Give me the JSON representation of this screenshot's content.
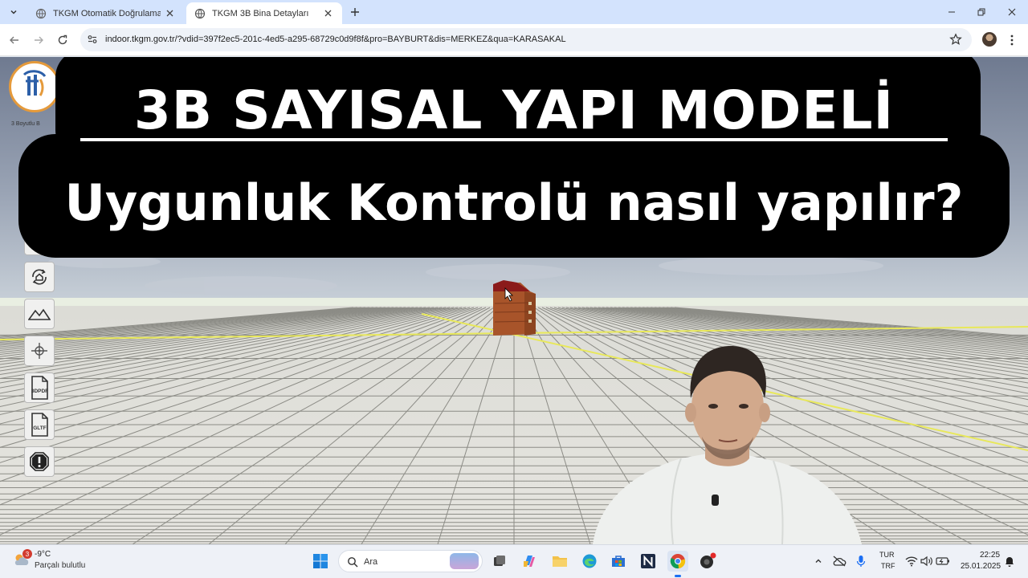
{
  "browser": {
    "tabs": [
      {
        "title": "TKGM Otomatik Doğrulama Uyg",
        "active": false
      },
      {
        "title": "TKGM 3B Bina Detayları",
        "active": true
      }
    ],
    "url": "indoor.tkgm.gov.tr/?vdid=397f2ec5-201c-4ed5-a295-68729c0d9f8f&pro=BAYBURT&dis=MERKEZ&qua=KARASAKAL"
  },
  "app": {
    "logo_text": "Tapu ve Kadastro",
    "logo_caption": "3 Boyutlu B",
    "side_buttons": [
      {
        "icon": "ruler-icon"
      },
      {
        "icon": "rotate-home-icon"
      },
      {
        "icon": "terrain-icon"
      },
      {
        "icon": "compass-icon"
      },
      {
        "icon": "3dpdf-icon",
        "label": "3DPDF"
      },
      {
        "icon": "gltf-icon",
        "label": "GLTF"
      },
      {
        "icon": "warning-icon"
      }
    ]
  },
  "overlay": {
    "line1": "3B SAYISAL YAPI MODELİ",
    "line2": "Uygunluk Kontrolü nasıl yapılır?"
  },
  "taskbar": {
    "weather_temp": "-9°C",
    "weather_desc": "Parçalı bulutlu",
    "weather_badge": "3",
    "search_placeholder": "Ara",
    "lang_top": "TUR",
    "lang_bottom": "TRF",
    "time": "22:25",
    "date": "25.01.2025"
  },
  "colors": {
    "tabstrip": "#d3e3fd",
    "overlay_bg": "#000000",
    "overlay_text": "#ffffff",
    "building": "#a0522d",
    "building_roof": "#8b1a1a",
    "horizon_line": "#e8e85a"
  }
}
